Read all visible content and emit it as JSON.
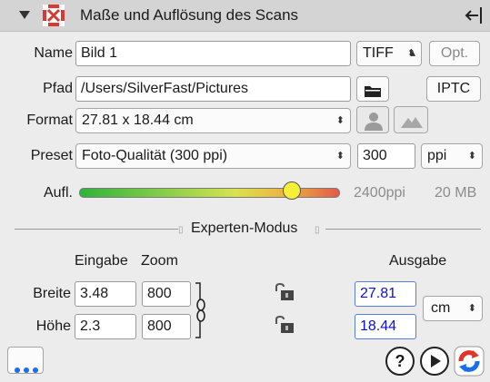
{
  "header": {
    "title": "Maße und Auflösung des Scans"
  },
  "name_row": {
    "label": "Name",
    "value": "Bild 1",
    "format": "TIFF",
    "opt_label": "Opt."
  },
  "path_row": {
    "label": "Pfad",
    "value": "/Users/SilverFast/Pictures",
    "iptc_label": "IPTC"
  },
  "format_row": {
    "label": "Format",
    "value": "27.81 x 18.44 cm"
  },
  "preset_row": {
    "label": "Preset",
    "value": "Foto-Qualität (300 ppi)",
    "ppi_value": "300",
    "unit": "ppi"
  },
  "resolution": {
    "label": "Aufl.",
    "ppi": "2400ppi",
    "size": "20 MB",
    "slider_fraction": 0.82
  },
  "expert": {
    "title": "Experten-Modus",
    "col_input": "Eingabe",
    "col_zoom": "Zoom",
    "col_output": "Ausgabe",
    "width_label": "Breite",
    "height_label": "Höhe",
    "width_input": "3.48",
    "width_zoom": "800",
    "height_input": "2.3",
    "height_zoom": "800",
    "width_output": "27.81",
    "height_output": "18.44",
    "output_unit": "cm"
  },
  "icons": {
    "accent_blue": "#1a6fe8",
    "close_red": "#e0342c"
  }
}
